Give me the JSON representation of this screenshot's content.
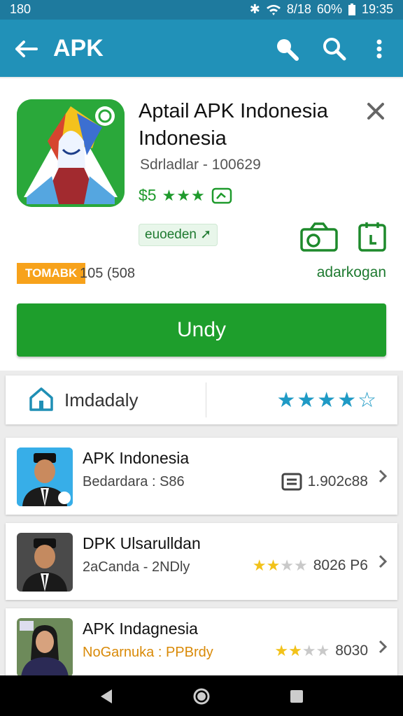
{
  "status_bar": {
    "left": "180",
    "right_signal": "8/18",
    "battery": "60%",
    "time": "19:35"
  },
  "app_bar": {
    "title": "APK"
  },
  "app": {
    "name": "Aptail APK Indonesia Indonesia",
    "developer": "Sdrladlar - 100629",
    "price": "$5",
    "rating_stars": "★★★",
    "tag": "euoeden",
    "orange_tag": "TOMABK",
    "count": "105 (508",
    "downloads_label": "adarkogan",
    "install_label": "Undy"
  },
  "section": {
    "label": "Imdadaly",
    "rating": "★★★★☆"
  },
  "list": [
    {
      "name": "APK Indonesia",
      "sub": "Bedardara : S86",
      "meta": "1.902c88"
    },
    {
      "name": "DPK Ulsarulldan",
      "sub": "2aCanda - 2NDly",
      "meta": "8026 P6",
      "rating": 2.5
    },
    {
      "name": "APK Indagnesia",
      "sub": "NoGarnuka : PPBrdy",
      "meta": "8030",
      "rating": 2.5
    }
  ],
  "colors": {
    "app_bar": "#2191b8",
    "install": "#1e9e2c",
    "accent_blue": "#1f9ac5",
    "star_yellow": "#f2c21a"
  }
}
